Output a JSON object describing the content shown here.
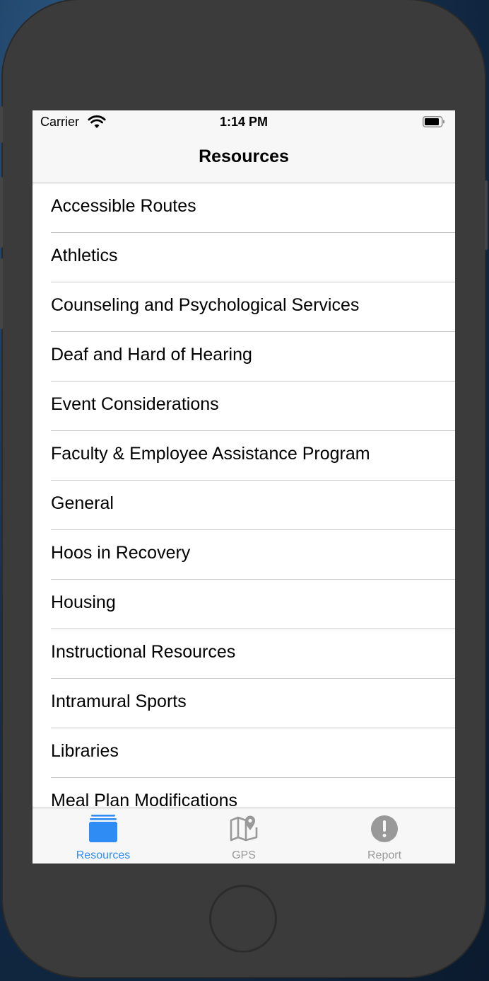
{
  "status_bar": {
    "carrier": "Carrier",
    "time": "1:14 PM"
  },
  "nav": {
    "title": "Resources"
  },
  "resources": [
    {
      "label": "Accessible Routes"
    },
    {
      "label": "Athletics"
    },
    {
      "label": "Counseling and Psychological Services"
    },
    {
      "label": "Deaf and Hard of Hearing"
    },
    {
      "label": "Event Considerations"
    },
    {
      "label": "Faculty & Employee Assistance Program"
    },
    {
      "label": "General"
    },
    {
      "label": "Hoos in Recovery"
    },
    {
      "label": "Housing"
    },
    {
      "label": "Instructional Resources"
    },
    {
      "label": "Intramural Sports"
    },
    {
      "label": "Libraries"
    },
    {
      "label": "Meal Plan Modifications"
    }
  ],
  "tab_bar": {
    "tabs": [
      {
        "label": "Resources",
        "icon": "stack-icon",
        "active": true
      },
      {
        "label": "GPS",
        "icon": "map-pin-icon",
        "active": false
      },
      {
        "label": "Report",
        "icon": "exclamation-circle-icon",
        "active": false
      }
    ]
  },
  "colors": {
    "accent": "#2f8cf5",
    "inactive": "#999999",
    "device_frame": "#3b3b3b"
  }
}
